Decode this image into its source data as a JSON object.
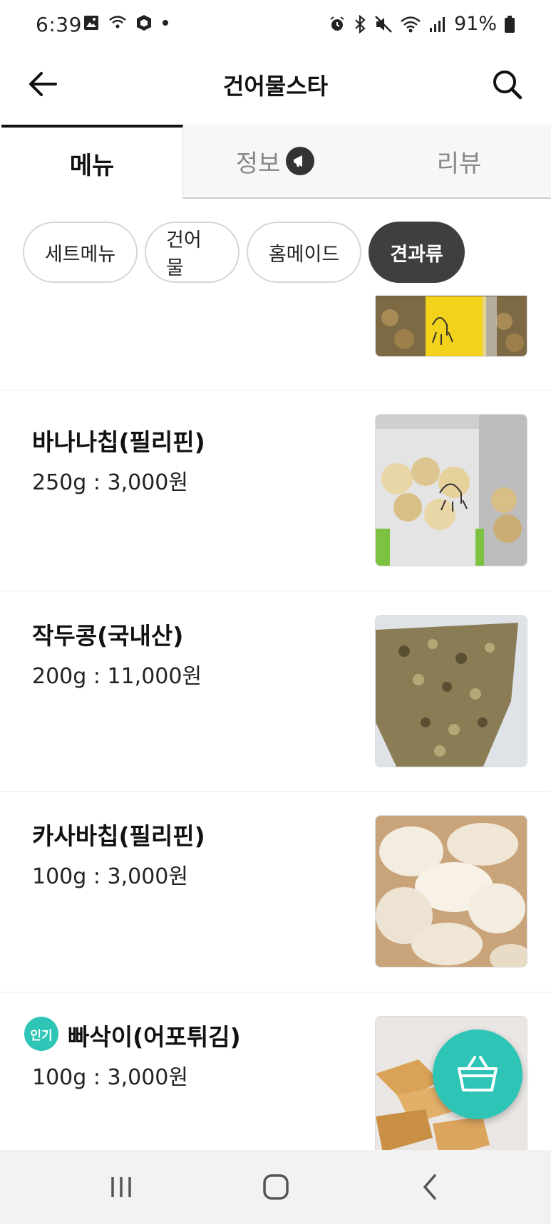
{
  "status_bar": {
    "time": "6:39",
    "battery": "91%",
    "left_icons": [
      "gallery-icon",
      "wifi-calling-icon",
      "cube-icon",
      "dot-icon"
    ],
    "right_icons": [
      "alarm-icon",
      "bluetooth-icon",
      "mute-icon",
      "wifi-icon",
      "signal-icon",
      "battery-icon"
    ]
  },
  "app_bar": {
    "title": "건어물스타"
  },
  "tabs": [
    {
      "label": "메뉴",
      "active": true
    },
    {
      "label": "정보",
      "active": false
    },
    {
      "label": "리뷰",
      "active": false
    }
  ],
  "categories": [
    {
      "label": "세트메뉴",
      "active": false
    },
    {
      "label": "건어물",
      "active": false
    },
    {
      "label": "홈메이드",
      "active": false
    },
    {
      "label": "견과류",
      "active": true
    }
  ],
  "items": [
    {
      "name": "",
      "price": ""
    },
    {
      "name": "바나나칩(필리핀)",
      "price": "250g : 3,000원"
    },
    {
      "name": "작두콩(국내산)",
      "price": "200g : 11,000원"
    },
    {
      "name": "카사바칩(필리핀)",
      "price": "100g : 3,000원"
    },
    {
      "name": "빠삭이(어포튀김)",
      "price": "100g : 3,000원",
      "badge": "인기"
    }
  ],
  "colors": {
    "accent": "#2ec4b6",
    "chip_active": "#3f3f3f"
  }
}
